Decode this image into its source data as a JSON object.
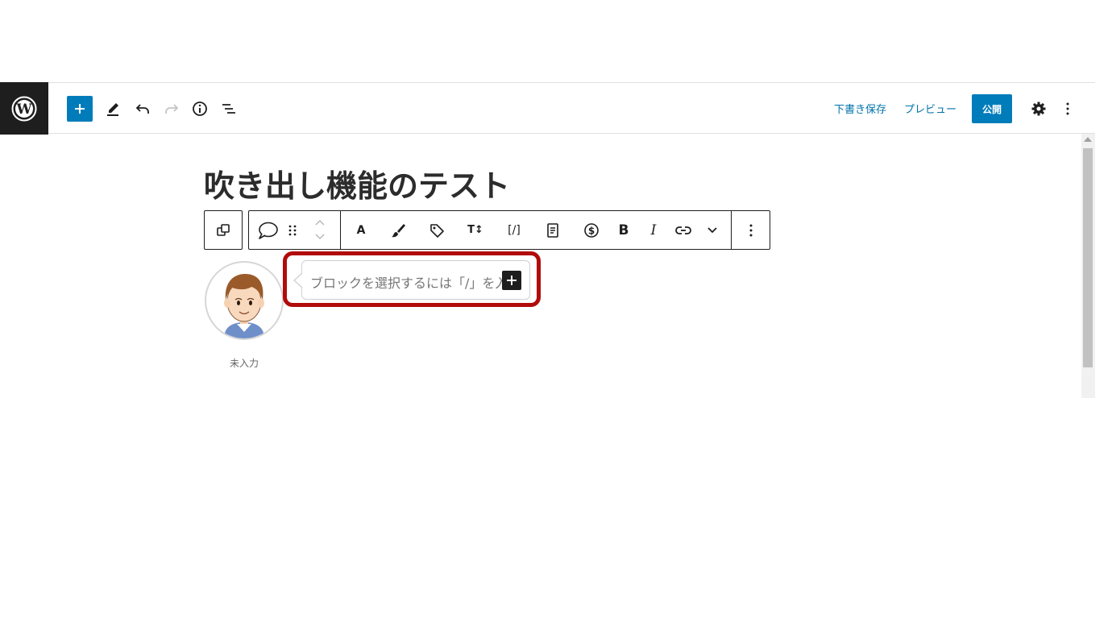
{
  "topbar": {
    "save_draft": "下書き保存",
    "preview": "プレビュー",
    "publish": "公開"
  },
  "post": {
    "title": "吹き出し機能のテスト"
  },
  "block_toolbar": {
    "text_label": "A",
    "font_size_label": "T↕",
    "shortcode_label": "[/]",
    "bold_label": "B",
    "italic_label": "I"
  },
  "balloon": {
    "speaker_name": "未入力",
    "placeholder": "ブロックを選択するには「/」を入力"
  },
  "colors": {
    "accent": "#007cba",
    "highlight": "#b10b0b",
    "dark": "#1e1e1e"
  }
}
